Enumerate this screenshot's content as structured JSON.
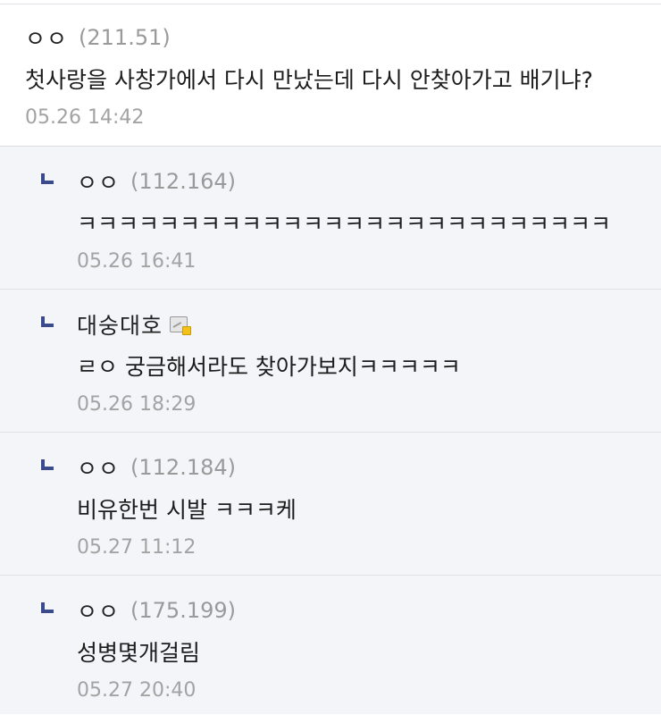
{
  "comment": {
    "nick": "ㅇㅇ",
    "ip": "(211.51)",
    "text": "첫사랑을 사창가에서 다시 만났는데 다시 안찾아가고 배기냐?",
    "date": "05.26 14:42"
  },
  "replies": [
    {
      "nick": "ㅇㅇ",
      "ip": "(112.164)",
      "text": "ㅋㅋㅋㅋㅋㅋㅋㅋㅋㅋㅋㅋㅋㅋㅋㅋㅋㅋㅋㅋㅋㅋㅋㅋㅋㅋ",
      "date": "05.26 16:41"
    },
    {
      "nick": "대숭대호",
      "member_icon": "fixed-nick-member-icon",
      "text": "ㄹㅇ 궁금해서라도 찾아가보지ㅋㅋㅋㅋㅋ",
      "date": "05.26 18:29"
    },
    {
      "nick": "ㅇㅇ",
      "ip": "(112.184)",
      "text": "비유한번 시발 ㅋㅋㅋ케",
      "date": "05.27 11:12"
    },
    {
      "nick": "ㅇㅇ",
      "ip": "(175.199)",
      "text": "성병몇개걸림",
      "date": "05.27 20:40"
    }
  ],
  "colors": {
    "reply_marker": "#3b4a8a",
    "reply_background": "#f4f5f9",
    "meta_text": "#9a9a9a"
  }
}
